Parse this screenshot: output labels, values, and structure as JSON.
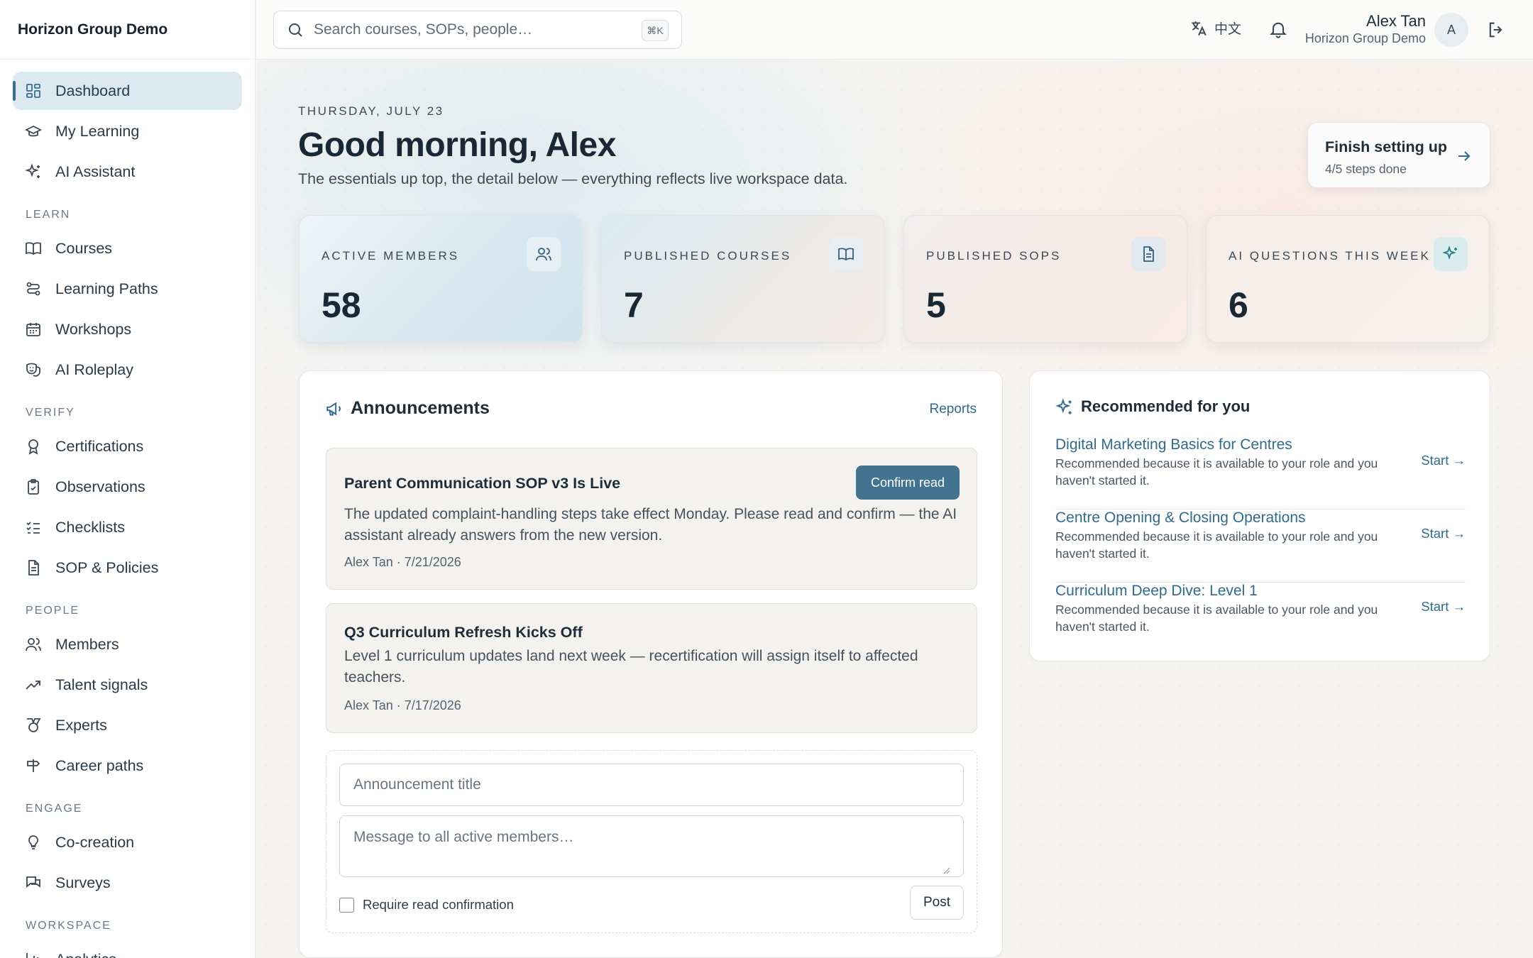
{
  "brand": "Horizon Group Demo",
  "sidebar": {
    "top": [
      {
        "label": "Dashboard",
        "icon": "dashboard-icon",
        "active": true
      },
      {
        "label": "My Learning",
        "icon": "graduation-cap-icon"
      },
      {
        "label": "AI Assistant",
        "icon": "sparkles-icon"
      }
    ],
    "learn": {
      "heading": "LEARN",
      "items": [
        {
          "label": "Courses",
          "icon": "book-open-icon"
        },
        {
          "label": "Learning Paths",
          "icon": "route-icon"
        },
        {
          "label": "Workshops",
          "icon": "calendar-icon"
        },
        {
          "label": "AI Roleplay",
          "icon": "theater-masks-icon"
        }
      ]
    },
    "verify": {
      "heading": "VERIFY",
      "items": [
        {
          "label": "Certifications",
          "icon": "award-icon"
        },
        {
          "label": "Observations",
          "icon": "clipboard-check-icon"
        },
        {
          "label": "Checklists",
          "icon": "list-checks-icon"
        },
        {
          "label": "SOP & Policies",
          "icon": "file-text-icon"
        }
      ]
    },
    "people": {
      "heading": "PEOPLE",
      "items": [
        {
          "label": "Members",
          "icon": "users-icon"
        },
        {
          "label": "Talent signals",
          "icon": "trending-up-icon"
        },
        {
          "label": "Experts",
          "icon": "medal-icon"
        },
        {
          "label": "Career paths",
          "icon": "signpost-icon"
        }
      ]
    },
    "engage": {
      "heading": "ENGAGE",
      "items": [
        {
          "label": "Co-creation",
          "icon": "lightbulb-icon"
        },
        {
          "label": "Surveys",
          "icon": "messages-icon"
        }
      ]
    },
    "workspace": {
      "heading": "WORKSPACE",
      "items": [
        {
          "label": "Analytics",
          "icon": "bar-chart-icon"
        }
      ]
    }
  },
  "topbar": {
    "search_placeholder": "Search courses, SOPs, people…",
    "shortcut": "⌘K",
    "language": "中文",
    "user_name": "Alex Tan",
    "user_org": "Horizon Group Demo",
    "avatar_initial": "A"
  },
  "header": {
    "date": "THURSDAY, JULY 23",
    "greeting": "Good morning, Alex",
    "subtitle": "The essentials up top, the detail below — everything reflects live workspace data."
  },
  "setup": {
    "title": "Finish setting up",
    "progress": "4/5 steps done"
  },
  "stats": [
    {
      "label": "ACTIVE MEMBERS",
      "value": "58",
      "icon": "users-icon"
    },
    {
      "label": "PUBLISHED COURSES",
      "value": "7",
      "icon": "book-open-icon"
    },
    {
      "label": "PUBLISHED SOPS",
      "value": "5",
      "icon": "file-text-icon"
    },
    {
      "label": "AI QUESTIONS THIS WEEK",
      "value": "6",
      "icon": "sparkles-icon"
    }
  ],
  "announcements": {
    "title": "Announcements",
    "reports_link": "Reports",
    "items": [
      {
        "title": "Parent Communication SOP v3 Is Live",
        "body": "The updated complaint-handling steps take effect Monday. Please read and confirm — the AI assistant already answers from the new version.",
        "meta": "Alex Tan · 7/21/2026",
        "action": "Confirm read"
      },
      {
        "title": "Q3 Curriculum Refresh Kicks Off",
        "body": "Level 1 curriculum updates land next week — recertification will assign itself to affected teachers.",
        "meta": "Alex Tan · 7/17/2026"
      }
    ],
    "composer": {
      "title_placeholder": "Announcement title",
      "message_placeholder": "Message to all active members…",
      "checkbox_label": "Require read confirmation",
      "post_label": "Post"
    }
  },
  "recommended": {
    "title": "Recommended for you",
    "items": [
      {
        "title": "Digital Marketing Basics for Centres",
        "reason": "Recommended because it is available to your role and you haven't started it.",
        "action": "Start →"
      },
      {
        "title": "Centre Opening & Closing Operations",
        "reason": "Recommended because it is available to your role and you haven't started it.",
        "action": "Start →"
      },
      {
        "title": "Curriculum Deep Dive: Level 1",
        "reason": "Recommended because it is available to your role and you haven't started it.",
        "action": "Start →"
      }
    ]
  }
}
